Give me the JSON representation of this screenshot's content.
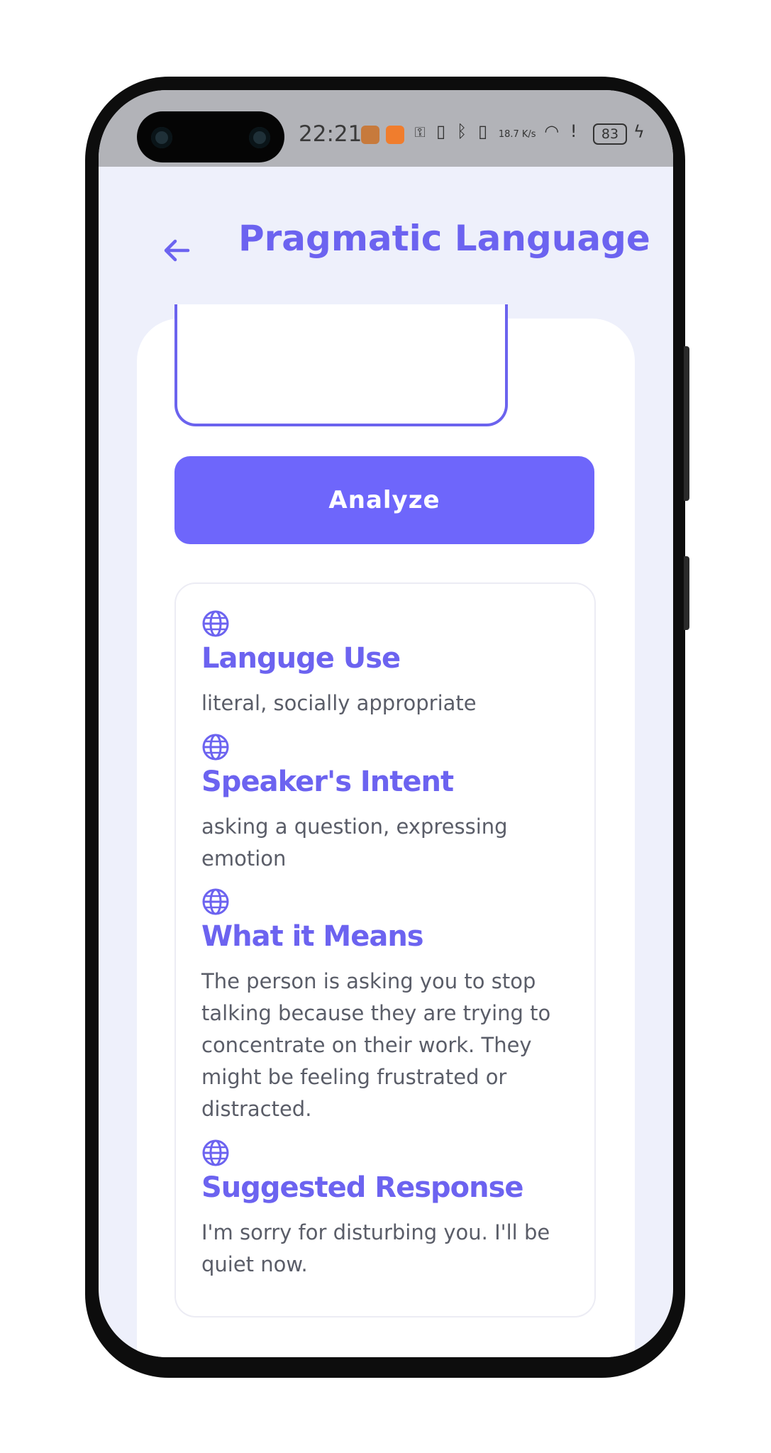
{
  "status_bar": {
    "time": "22:21",
    "icons": [
      "app-notification-icon",
      "app-notification-icon",
      "key-icon",
      "nfc-icon",
      "bluetooth-icon",
      "vibrate-icon",
      "network-speed",
      "wifi-icon",
      "alert-icon",
      "battery-icon",
      "charging-icon"
    ],
    "network_speed": "18.7 K/s",
    "battery": "83"
  },
  "header": {
    "title": "Pragmatic Language",
    "back_icon": "arrow-left-icon"
  },
  "form": {
    "input_value": "",
    "analyze_label": "Analyze"
  },
  "results": [
    {
      "icon": "globe-icon",
      "title": "Languge Use",
      "text": "literal, socially appropriate"
    },
    {
      "icon": "globe-icon",
      "title": "Speaker's Intent",
      "text": "asking a question, expressing emotion"
    },
    {
      "icon": "globe-icon",
      "title": "What it Means",
      "text": "The person is asking you to stop talking because they are trying to concentrate on their work. They might be feeling frustrated or distracted."
    },
    {
      "icon": "globe-icon",
      "title": "Suggested Response",
      "text": "I'm sorry for disturbing you. I'll be quiet now."
    }
  ],
  "colors": {
    "accent": "#6c63f0",
    "button": "#6e66fb",
    "background": "#eef0fb",
    "body_text": "#5a5d68"
  }
}
